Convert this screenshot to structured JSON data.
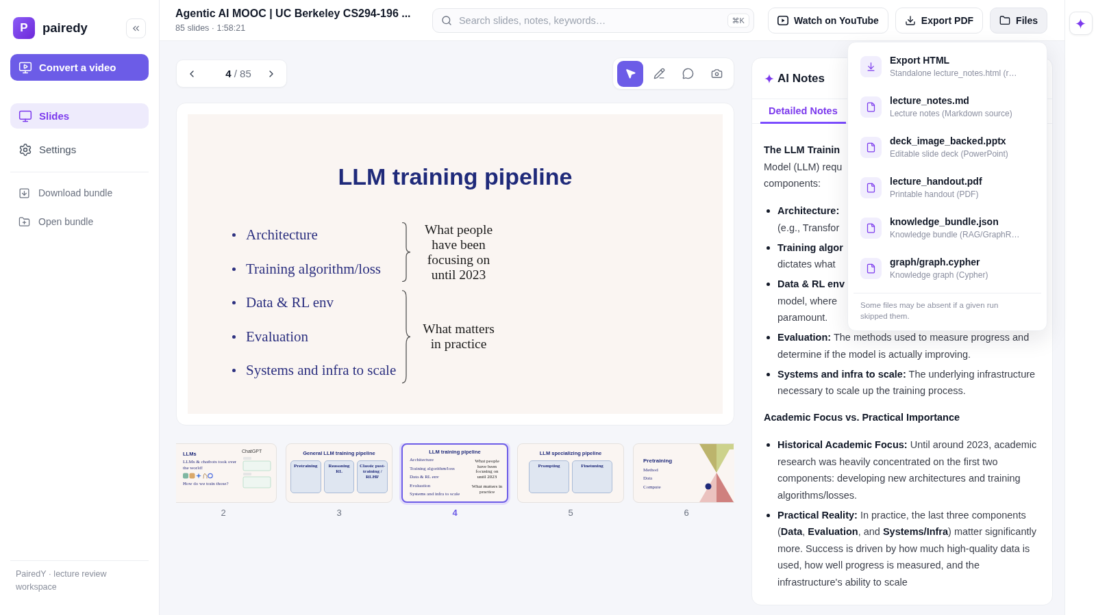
{
  "sidebar": {
    "brand_letter": "P",
    "brand_name": "pairedy",
    "convert_button": "Convert a video",
    "nav": [
      {
        "kind": "slides",
        "label": "Slides",
        "selected": true
      },
      {
        "kind": "settings",
        "label": "Settings",
        "selected": false
      }
    ],
    "actions": [
      {
        "kind": "download",
        "label": "Download bundle"
      },
      {
        "kind": "open",
        "label": "Open bundle"
      }
    ],
    "footer": "PairedY · lecture review workspace"
  },
  "header": {
    "title": "Agentic AI MOOC | UC Berkeley CS294-196 ...",
    "subtitle": "85 slides · 1:58:21",
    "search": {
      "placeholder": "Search slides, notes, keywords…",
      "shortcut": "⌘K"
    },
    "buttons": [
      {
        "kind": "youtube",
        "label": "Watch on YouTube",
        "expanded": false
      },
      {
        "kind": "pdf",
        "label": "Export PDF",
        "expanded": false
      },
      {
        "kind": "files",
        "label": "Files",
        "expanded": true
      }
    ]
  },
  "files_menu": {
    "items": [
      {
        "kind": "download",
        "name": "Export HTML",
        "description": "Standalone lecture_notes.html (r…"
      },
      {
        "kind": "file",
        "name": "lecture_notes.md",
        "description": "Lecture notes (Markdown source)"
      },
      {
        "kind": "file",
        "name": "deck_image_backed.pptx",
        "description": "Editable slide deck (PowerPoint)"
      },
      {
        "kind": "file",
        "name": "lecture_handout.pdf",
        "description": "Printable handout (PDF)"
      },
      {
        "kind": "file",
        "name": "knowledge_bundle.json",
        "description": "Knowledge bundle (RAG/GraphR…"
      },
      {
        "kind": "file",
        "name": "graph/graph.cypher",
        "description": "Knowledge graph (Cypher)"
      }
    ],
    "note": "Some files may be absent if a given run skipped them."
  },
  "pager": {
    "current": "4",
    "separator": "/",
    "total": "85"
  },
  "tools": [
    {
      "kind": "pointer",
      "selected": true
    },
    {
      "kind": "pen",
      "selected": false
    },
    {
      "kind": "comment",
      "selected": false
    },
    {
      "kind": "camera",
      "selected": false
    }
  ],
  "slide": {
    "title": "LLM training pipeline",
    "groups": [
      {
        "bullets": [
          "Architecture",
          "Training algorithm/loss"
        ],
        "label": "What people have been focusing on until 2023"
      },
      {
        "bullets": [
          "Data & RL env",
          "Evaluation",
          "Systems and infra to scale"
        ],
        "label": "What matters in practice"
      }
    ]
  },
  "thumbnails": [
    {
      "number": "2",
      "selected": false,
      "kind": "chat",
      "title": "LLMs",
      "bullets": [
        "LLMs & chatbots took over the world!",
        "How do we train those?"
      ],
      "side_title": "ChatGPT"
    },
    {
      "number": "3",
      "selected": false,
      "kind": "boxes",
      "title": "General LLM training pipeline",
      "boxes": [
        "Pretraining",
        "Reasoning RL",
        "Classic post-training / RLHF"
      ]
    },
    {
      "number": "4",
      "selected": true,
      "kind": "bullets",
      "title": "LLM training pipeline",
      "bullets": [
        "Architecture",
        "Training algorithm/loss",
        "Data & RL env",
        "Evaluation",
        "Systems and infra to scale"
      ],
      "notes": [
        "What people have been focusing on until 2023",
        "What matters in practice"
      ]
    },
    {
      "number": "5",
      "selected": false,
      "kind": "boxes",
      "title": "LLM specializing pipeline",
      "boxes": [
        "Prompting",
        "Finetuning"
      ]
    },
    {
      "number": "6",
      "selected": false,
      "kind": "graphic",
      "title": "Pretraining",
      "bullets": [
        "Method",
        "Data",
        "Compute"
      ]
    }
  ],
  "notes": {
    "title": "AI Notes",
    "tabs": [
      {
        "label": "Detailed Notes",
        "selected": true
      }
    ],
    "intro": {
      "lead": "The LLM Trainin",
      "lines": [
        "Model (LLM) requ",
        "components:"
      ]
    },
    "clipped_points": [
      {
        "term": "Architecture:",
        "lines": [
          "(e.g., Transfor"
        ]
      },
      {
        "term": "Training algor",
        "lines": [
          "dictates what"
        ]
      },
      {
        "term": "Data & RL env",
        "lines": [
          "model, where",
          "paramount."
        ]
      }
    ],
    "points": [
      "**Evaluation:** The methods used to measure progress and determine if the model is actually improving.",
      "**Systems and infra to scale:** The underlying infrastructure necessary to scale up the training process."
    ],
    "sections": [
      {
        "heading": "Academic Focus vs. Practical Importance",
        "points": [
          "**Historical Academic Focus:** Until around 2023, academic research was heavily concentrated on the first two components: developing new architectures and training algorithms/losses.",
          "**Practical Reality:** In practice, the last three components (**Data**, **Evaluation**, and **Systems/Infra**) matter significantly more. Success is driven by how much high-quality data is used, how well progress is measured, and the infrastructure's ability to scale"
        ]
      }
    ]
  }
}
